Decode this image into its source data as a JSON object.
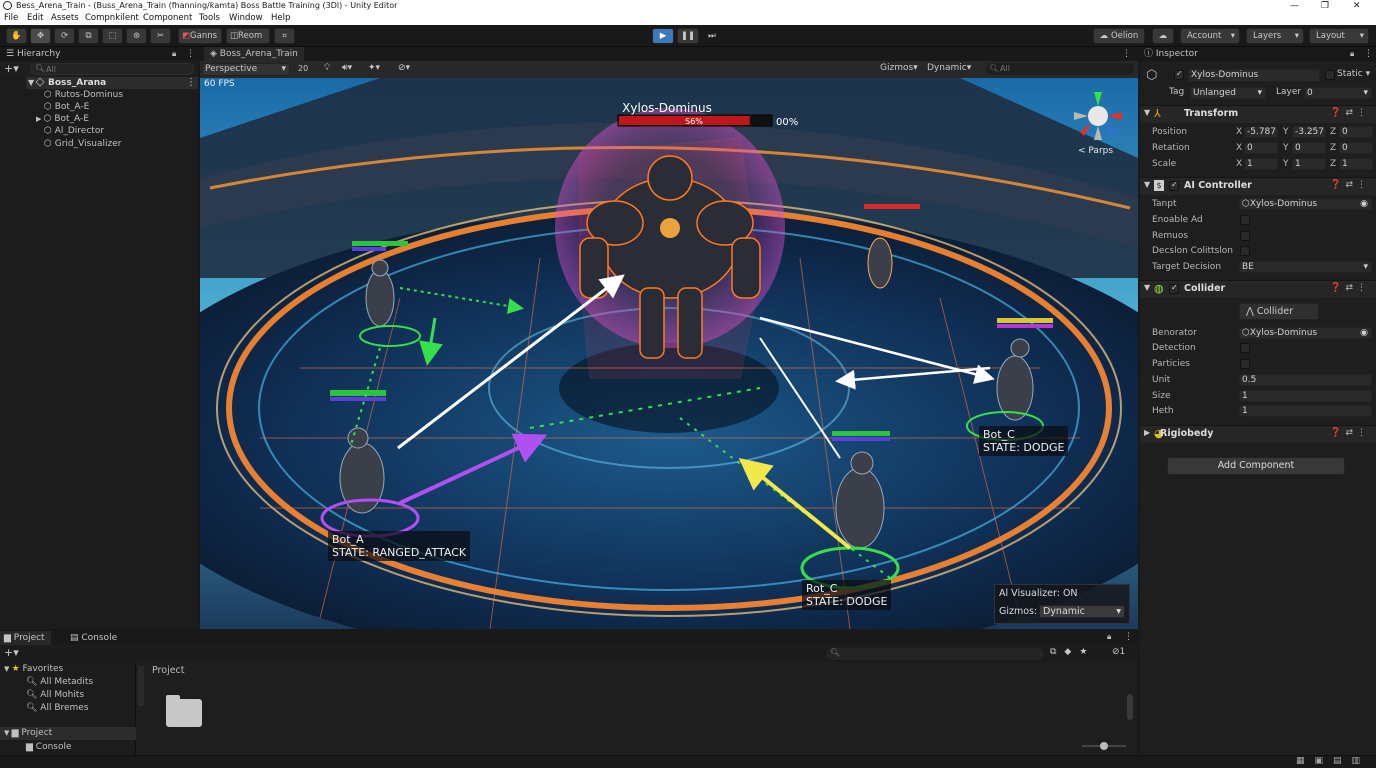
{
  "window": {
    "title": "Bess_Arena_Train - (Buss_Arena_Train (fhanning/ƙamta) Boss Battle Training (3Dl) - Unity Editor",
    "controls": [
      "—",
      "❐",
      "✕"
    ]
  },
  "menu": [
    "File",
    "Edit",
    "Assets",
    "Compnkilent",
    "Component",
    "Tools",
    "Window",
    "Help"
  ],
  "toolbar": {
    "tools": [
      "hand-tool",
      "move-tool",
      "rotate-tool",
      "scale-tool",
      "rect-tool",
      "transform-tool",
      "custom-tool"
    ],
    "ganns": "Ganns",
    "reom": "Reom",
    "oelion": "Oelion",
    "account": "Account",
    "layers": "Layers",
    "layout": "Layout"
  },
  "hierarchy": {
    "tab": "Hierarchy",
    "search": "All",
    "root": "Boss_Arana",
    "items": [
      "Rutos-Dominus",
      "Bot_A-E",
      "Bot_A-E",
      "Al_Director",
      "Grid_Visualizer"
    ]
  },
  "scene": {
    "tab": "Boss_Arena_Train",
    "view_mode": "Perspective",
    "mode_2d": "20",
    "gizmos": "Gizmos",
    "dynamic": "Dynamic",
    "search": "All",
    "fps": "60 FPS",
    "persp_label": "< Parps",
    "boss": {
      "name": "Xylos-Dominus",
      "hp_text": "S6%",
      "hp_pct_text": "00%",
      "hp_fraction": 0.86
    },
    "bots": [
      {
        "name": "Bot_A",
        "state_label": "STATE:",
        "state": "RANGED_ATTACK"
      },
      {
        "name": "Bot_C",
        "state_label": "STATE:",
        "state": "DODGE"
      },
      {
        "name": "Rot_C",
        "state_label": "STATE:",
        "state": "DODGE"
      }
    ],
    "overlay": {
      "visualizer": "Al Visualizer: ON",
      "gizmos_label": "Gizmos:",
      "gizmos_value": "Dynamic"
    }
  },
  "inspector": {
    "tab": "Inspector",
    "object_name": "Xylos-Dominus",
    "static": "Static",
    "tag_label": "Tag",
    "tag_value": "Unlanged",
    "layer_label": "Layer",
    "layer_value": "0",
    "transform": {
      "title": "Transform",
      "rows": [
        {
          "label": "Position",
          "x": "-5.787",
          "y": "-3.257",
          "z": "0"
        },
        {
          "label": "Retation",
          "x": "0",
          "y": "0",
          "z": "0"
        },
        {
          "label": "Scale",
          "x": "1",
          "y": "1",
          "z": "1"
        }
      ]
    },
    "ai_controller": {
      "title": "AI Controller",
      "tanpt_label": "Tanpt",
      "tanpt_value": "Xylos-Dominus",
      "enoable": "Enoable Ad",
      "remuos": "Remuos",
      "decision_col": "Decslon Colittslon",
      "target_decision": "Target Decision",
      "target_value": "BE"
    },
    "collider": {
      "title": "Collider",
      "edit_btn": "Collider",
      "benorator_label": "Benorator",
      "benorator_value": "Xylos-Dominus",
      "detection": "Detection",
      "particles": "Particies",
      "unit_label": "Unit",
      "unit_value": "0.5",
      "size_label": "Size",
      "size_value": "1",
      "heth_label": "Heth",
      "heth_value": "1"
    },
    "rigidbody": {
      "title": "Rigiobedy"
    },
    "add_component": "Add Component"
  },
  "project": {
    "tabs": [
      "Project",
      "Console"
    ],
    "favorites": "Favorites",
    "fav_items": [
      "All Metadits",
      "All Mohits",
      "All Bremes"
    ],
    "project_root": "Project",
    "console_item": "Console",
    "breadcrumb": "Project",
    "badge": "1"
  },
  "colors": {
    "accent": "#3a79bb",
    "boss_hp": "#c0161b",
    "bot_hp": "#2bc43a",
    "bot_mana": "#5a3fd9"
  }
}
